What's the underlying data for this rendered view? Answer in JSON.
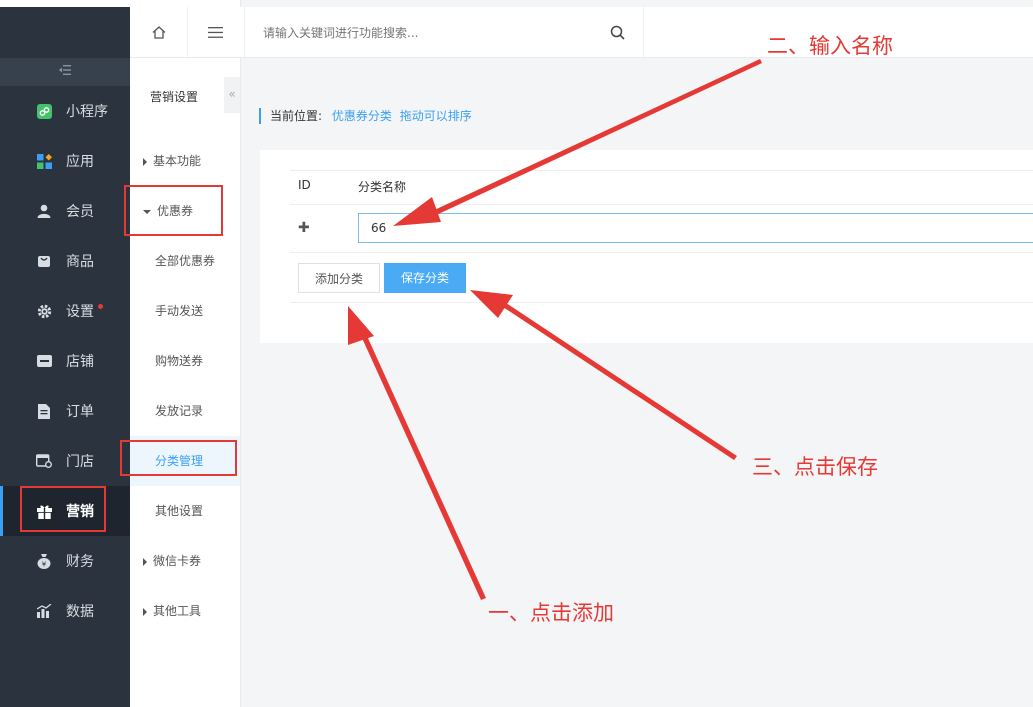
{
  "sidebar": {
    "items": [
      {
        "label": "小程序",
        "icon": "mini-program-icon"
      },
      {
        "label": "应用",
        "icon": "apps-icon"
      },
      {
        "label": "会员",
        "icon": "user-icon"
      },
      {
        "label": "商品",
        "icon": "shopping-bag-icon"
      },
      {
        "label": "设置",
        "icon": "gear-icon"
      },
      {
        "label": "店铺",
        "icon": "store-icon"
      },
      {
        "label": "订单",
        "icon": "document-icon"
      },
      {
        "label": "门店",
        "icon": "shop-icon"
      },
      {
        "label": "营销",
        "icon": "gift-icon",
        "active": true
      },
      {
        "label": "财务",
        "icon": "money-bag-icon"
      },
      {
        "label": "数据",
        "icon": "bar-chart-icon"
      }
    ]
  },
  "subnav": {
    "title": "营销设置",
    "items": [
      {
        "label": "基本功能"
      },
      {
        "label": "优惠券"
      },
      {
        "label": "全部优惠券"
      },
      {
        "label": "手动发送"
      },
      {
        "label": "购物送券"
      },
      {
        "label": "发放记录"
      },
      {
        "label": "分类管理",
        "active": true
      },
      {
        "label": "其他设置"
      },
      {
        "label": "微信卡券"
      },
      {
        "label": "其他工具"
      }
    ]
  },
  "search": {
    "placeholder": "请输入关键词进行功能搜索..."
  },
  "breadcrumb": {
    "prefix": "当前位置:",
    "page": "优惠券分类",
    "hint": "拖动可以排序"
  },
  "table": {
    "col_id": "ID",
    "col_name": "分类名称",
    "row_value": "66"
  },
  "buttons": {
    "add": "添加分类",
    "save": "保存分类"
  },
  "annotations": {
    "step1": "一、点击添加",
    "step2": "二、输入名称",
    "step3": "三、点击保存"
  },
  "colors": {
    "accent": "#3aa0f3",
    "annotation": "#e53935",
    "sidebar_bg": "#2b333e"
  }
}
